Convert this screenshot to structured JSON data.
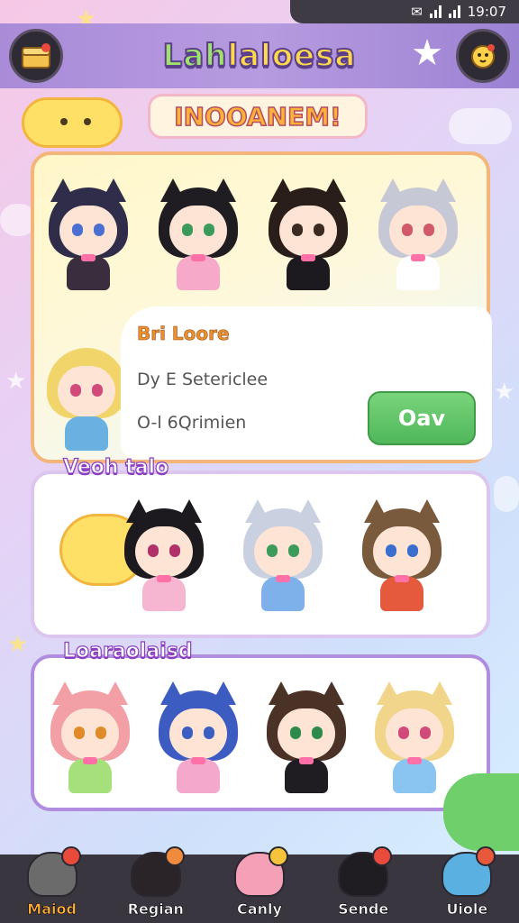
{
  "status_bar": {
    "time": "19:07"
  },
  "header": {
    "app_title_part1": "Lah",
    "app_title_part2": "laloesa",
    "left_button_icon": "treasure-chest-icon",
    "right_button_icon": "chick-icon"
  },
  "banner": {
    "text": "INOOANEM!"
  },
  "featured_card": {
    "title": "Bri Loore",
    "line1": "Dy E Setericlee",
    "line2": "O-l 6Qrimien",
    "button_label": "Oav",
    "characters": [
      {
        "hair": "#2f2d4a",
        "eyes": "#4a6fd0",
        "body": "#3a2d3d"
      },
      {
        "hair": "#1f1c22",
        "eyes": "#3c9a5a",
        "body": "#f6a9c9"
      },
      {
        "hair": "#2a1e1a",
        "eyes": "#3a2a22",
        "body": "#1d1a1f"
      },
      {
        "hair": "#c6c8d6",
        "eyes": "#d05a6a",
        "body": "#ffffff"
      }
    ]
  },
  "section2": {
    "title": "Veoh talo",
    "characters": [
      {
        "hair": "#1d1a1f",
        "eyes": "#b0306a",
        "body": "#f6b6d2"
      },
      {
        "hair": "#c9d1e0",
        "eyes": "#3c9a5a",
        "body": "#7eb1ea"
      },
      {
        "hair": "#7a5a3c",
        "eyes": "#3a6fd0",
        "body": "#e55a3c"
      }
    ]
  },
  "section3": {
    "title": "Loaraolaisd",
    "characters": [
      {
        "hair": "#f2a0a6",
        "eyes": "#e08a2a",
        "body": "#a6e07a"
      },
      {
        "hair": "#3d5cc2",
        "eyes": "#3a5fc0",
        "body": "#f4a8cc"
      },
      {
        "hair": "#4a3326",
        "eyes": "#2e8a4a",
        "body": "#1f1c22"
      },
      {
        "hair": "#f1d58a",
        "eyes": "#d04a7a",
        "body": "#8ac4f0"
      }
    ]
  },
  "nav": {
    "items": [
      {
        "label": "Maiod",
        "avatar": "#6b6b6b",
        "badge": "#e84a3c",
        "active": true
      },
      {
        "label": "Regian",
        "avatar": "#2a2428",
        "badge": "#f08a3c",
        "active": false
      },
      {
        "label": "Canly",
        "avatar": "#f4a0b6",
        "badge": "#f5c43c",
        "active": false
      },
      {
        "label": "Sende",
        "avatar": "#1f1c22",
        "badge": "#e84a3c",
        "active": false
      },
      {
        "label": "Uiole",
        "avatar": "#5ab0e0",
        "badge": "#e8593c",
        "active": false
      }
    ]
  }
}
